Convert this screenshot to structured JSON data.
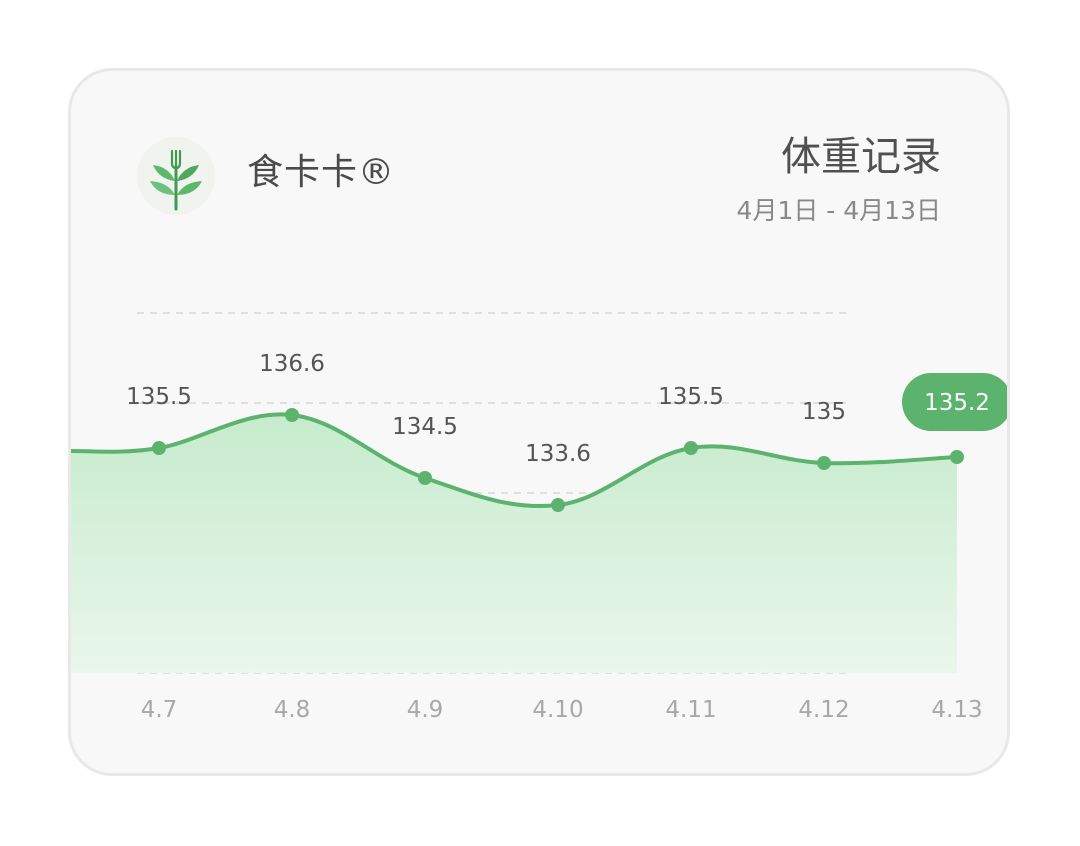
{
  "header": {
    "app_name": "食卡卡®",
    "title": "体重记录",
    "date_range": "4月1日 - 4月13日"
  },
  "icons": {
    "logo": "leaf-fork-logo-icon"
  },
  "colors": {
    "accent": "#5bb36e",
    "fill_top": "#c6ebcc",
    "fill_bottom": "#eaf7ec",
    "card_bg": "#f8f8f8"
  },
  "chart_data": {
    "type": "area",
    "x": [
      "4.7",
      "4.8",
      "4.9",
      "4.10",
      "4.11",
      "4.12",
      "4.13"
    ],
    "values": [
      135.5,
      136.6,
      134.5,
      133.6,
      135.5,
      135,
      135.2
    ],
    "data_labels": [
      "135.5",
      "136.6",
      "134.5",
      "133.6",
      "135.5",
      "135",
      "135.2"
    ],
    "highlighted_index": 6,
    "grid": "dashed-horizontal",
    "ylim": [
      128,
      140
    ],
    "title": "",
    "xlabel": "",
    "ylabel": ""
  }
}
